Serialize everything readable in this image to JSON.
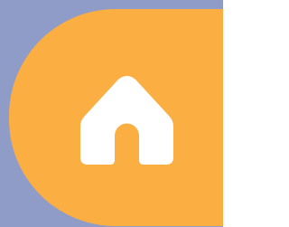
{
  "colors": {
    "backdrop": "#8f9cc8",
    "tab_fill": "#fbae42",
    "icon_fill": "#ffffff"
  },
  "home_tab": {
    "icon": "home-icon",
    "state": "selected"
  }
}
